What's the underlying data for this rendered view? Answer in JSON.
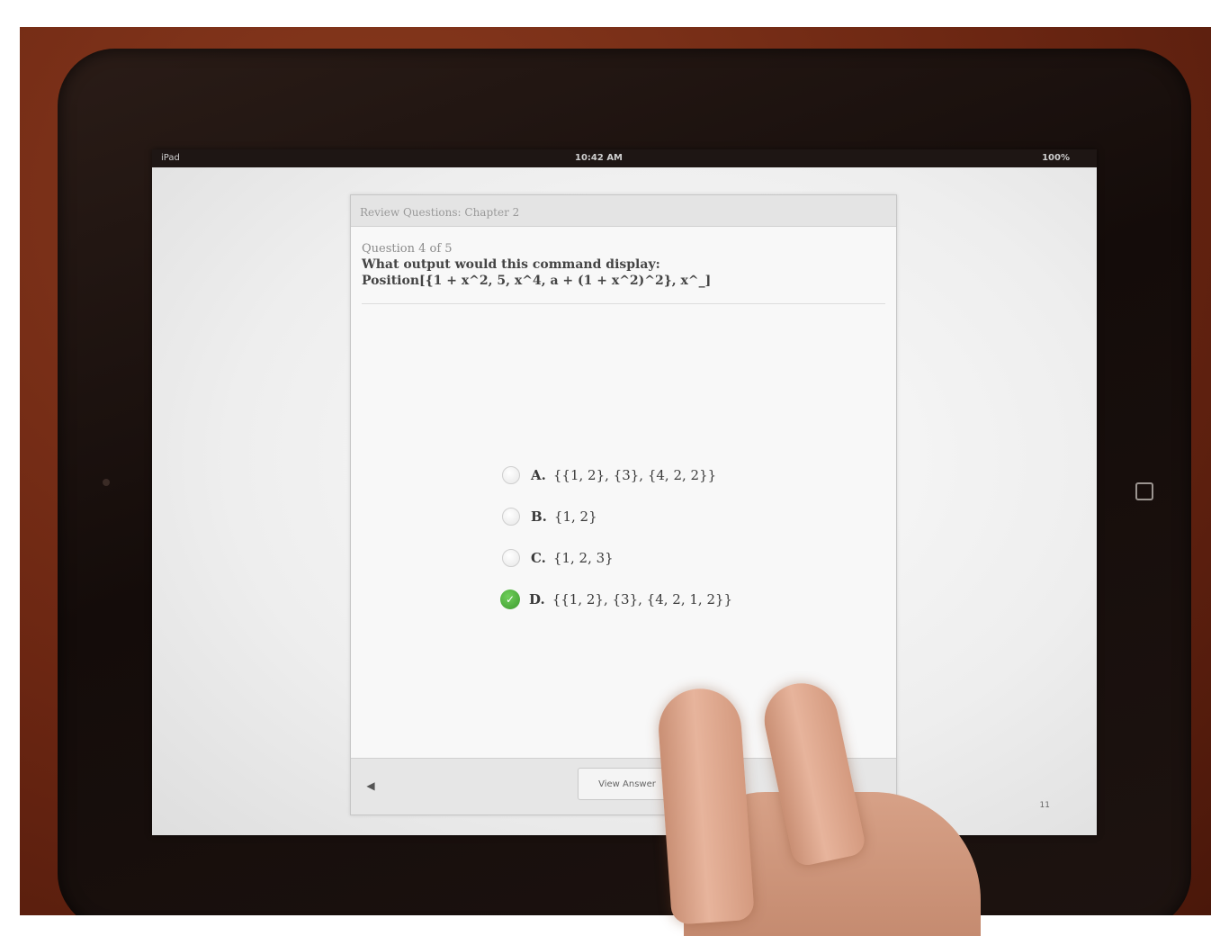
{
  "status_bar": {
    "carrier": "iPad",
    "time": "10:42 AM",
    "battery": "100%"
  },
  "quiz": {
    "header_title": "Review Questions: Chapter 2",
    "question_counter": "Question 4 of 5",
    "question_text": "What output would this command display:",
    "question_code": "Position[{1 + x^2, 5, x^4, a + (1 + x^2)^2}, x^_]",
    "options": [
      {
        "letter": "A.",
        "text": "{{1, 2}, {3}, {4, 2, 2}}",
        "selected": false
      },
      {
        "letter": "B.",
        "text": "{1, 2}",
        "selected": false
      },
      {
        "letter": "C.",
        "text": "{1, 2, 3}",
        "selected": false
      },
      {
        "letter": "D.",
        "text": "{{1, 2}, {3}, {4, 2, 1, 2}}",
        "selected": true
      }
    ],
    "prev_arrow": "◀",
    "view_answer_label": "View Answer",
    "check_glyph": "✓"
  },
  "page_number": "11",
  "icons": {
    "prev": "left-arrow-icon",
    "check": "checkmark-icon",
    "home": "home-button-icon"
  },
  "colors": {
    "selected_green": "#3d9a2f",
    "table_wood": "#6b2612"
  }
}
